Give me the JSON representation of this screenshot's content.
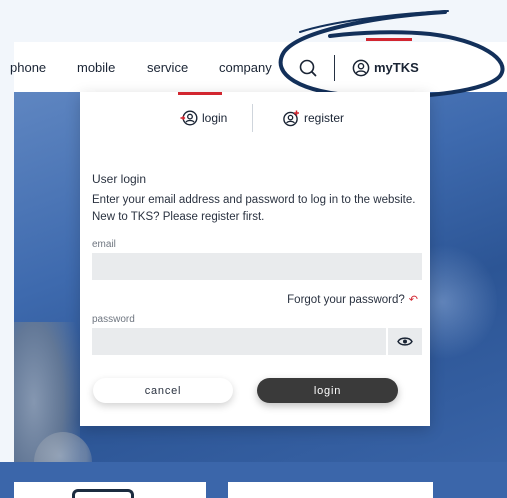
{
  "nav": {
    "items": [
      {
        "name": "nav-phone",
        "label": "phone"
      },
      {
        "name": "nav-mobile",
        "label": "mobile"
      },
      {
        "name": "nav-service",
        "label": "service"
      },
      {
        "name": "nav-company",
        "label": "company"
      }
    ],
    "account_label": "myTKS",
    "search_icon": "search-icon",
    "account_icon": "user-circle-icon"
  },
  "login_panel": {
    "tabs": {
      "login": "login",
      "register": "register"
    },
    "title": "User login",
    "description_line1": "Enter your email address and password to log in to the website.",
    "description_line2": "New to TKS? Please register first.",
    "email_label": "email",
    "email_value": "",
    "forgot_label": "Forgot your password?",
    "password_label": "password",
    "password_value": "",
    "cancel_label": "cancel",
    "login_label": "login"
  },
  "colors": {
    "accent_red": "#d22630",
    "background_blue": "#3b66aa",
    "annotation_ink": "#13305a",
    "login_button": "#3a3a3a"
  }
}
